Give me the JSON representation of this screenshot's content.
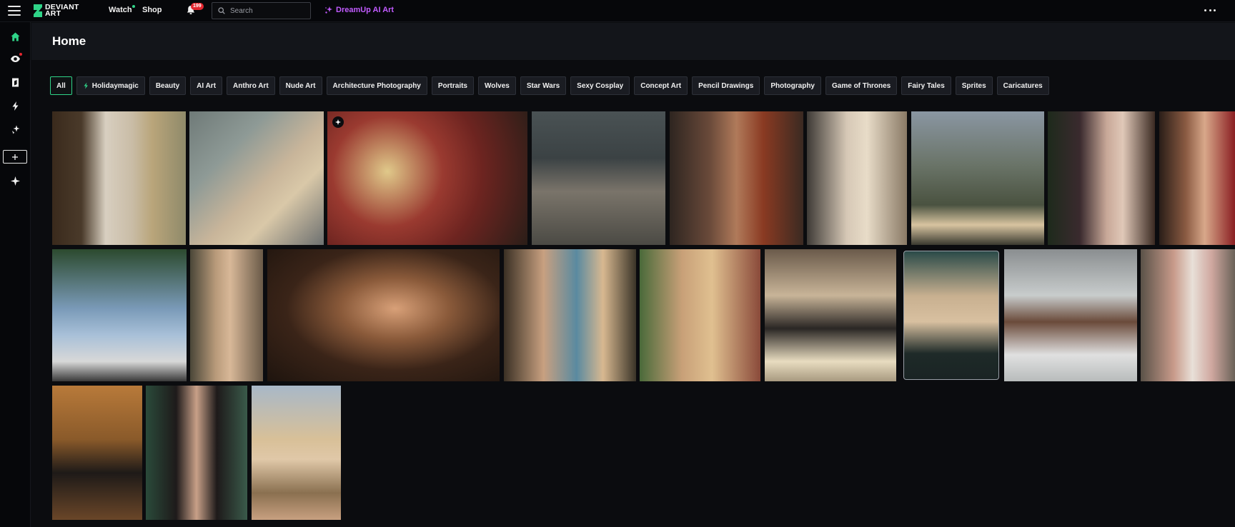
{
  "topbar": {
    "logo_line1": "DEVIANT",
    "logo_line2": "ART",
    "watch": "Watch",
    "shop": "Shop",
    "notifications_count": "199",
    "search_placeholder": "Search",
    "dreamup": "DreamUp AI Art"
  },
  "sidebar": {
    "items": [
      {
        "name": "home-icon",
        "active": true
      },
      {
        "name": "eye-icon",
        "active": false
      },
      {
        "name": "bookmark-icon",
        "active": false
      },
      {
        "name": "lightning-icon",
        "active": false
      },
      {
        "name": "dreamup-icon",
        "active": false
      },
      {
        "name": "plus-icon",
        "active": false
      },
      {
        "name": "sparkle-icon",
        "active": false
      }
    ]
  },
  "page": {
    "title": "Home"
  },
  "chips": [
    {
      "label": "All",
      "active": true
    },
    {
      "label": "Holidaymagic",
      "active": false,
      "icon": "bolt-icon"
    },
    {
      "label": "Beauty",
      "active": false
    },
    {
      "label": "AI Art",
      "active": false
    },
    {
      "label": "Anthro Art",
      "active": false
    },
    {
      "label": "Nude Art",
      "active": false
    },
    {
      "label": "Architecture Photography",
      "active": false
    },
    {
      "label": "Portraits",
      "active": false
    },
    {
      "label": "Wolves",
      "active": false
    },
    {
      "label": "Star Wars",
      "active": false
    },
    {
      "label": "Sexy Cosplay",
      "active": false
    },
    {
      "label": "Concept Art",
      "active": false
    },
    {
      "label": "Pencil Drawings",
      "active": false
    },
    {
      "label": "Photography",
      "active": false
    },
    {
      "label": "Game of Thrones",
      "active": false
    },
    {
      "label": "Fairy Tales",
      "active": false
    },
    {
      "label": "Sprites",
      "active": false
    },
    {
      "label": "Caricatures",
      "active": false
    }
  ],
  "colors": {
    "accent_green": "#2fd488",
    "dreamup_purple": "#c15bff",
    "badge_red": "#e3262f",
    "background": "#0b0c0f"
  }
}
